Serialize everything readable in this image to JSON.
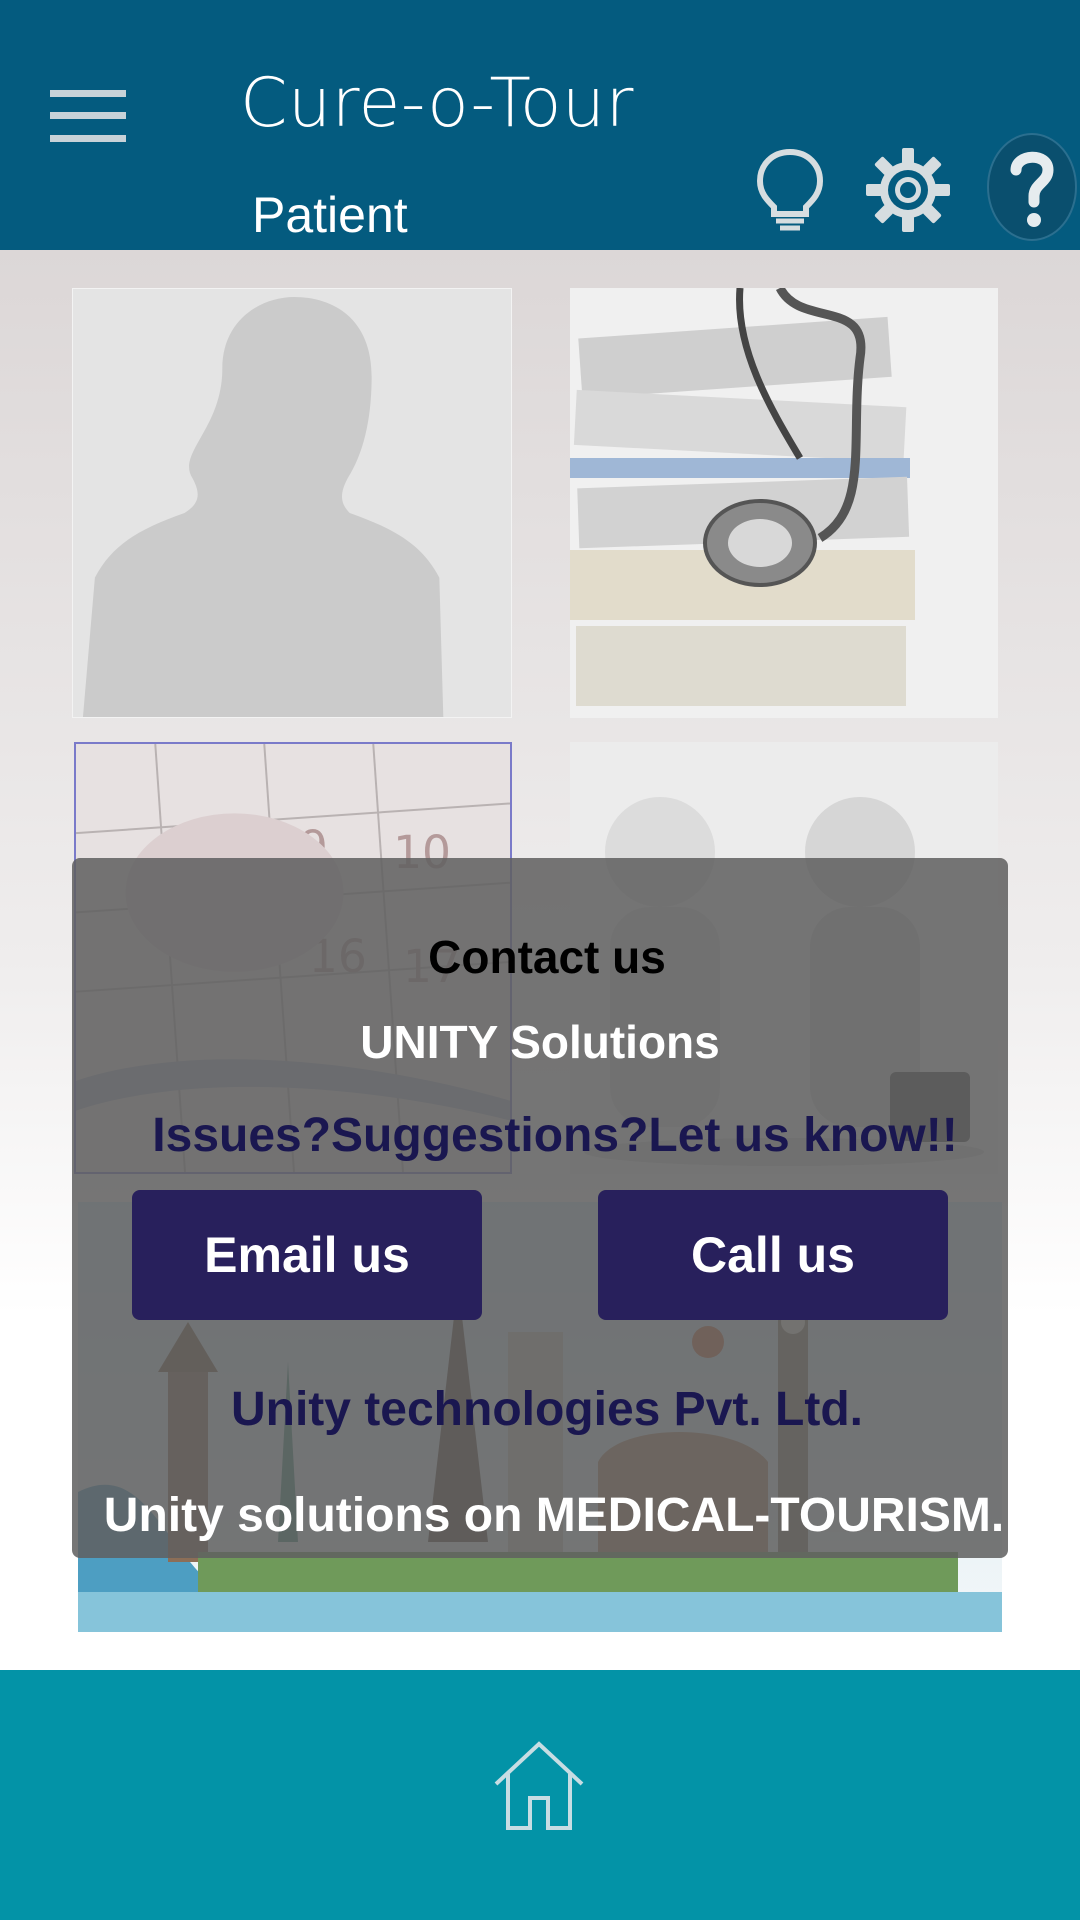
{
  "header": {
    "title": "Cure-o-Tour",
    "subtitle": "Patient",
    "icons": [
      "menu-icon",
      "lightbulb-icon",
      "gear-icon",
      "help-icon"
    ]
  },
  "tiles": [
    {
      "name": "profile",
      "image": "person-silhouette"
    },
    {
      "name": "medical-records",
      "image": "stethoscope-on-files"
    },
    {
      "name": "appointments",
      "image": "calendar"
    },
    {
      "name": "consultation",
      "image": "3d-figures-meeting"
    },
    {
      "name": "travel",
      "image": "world-landmarks"
    }
  ],
  "dialog": {
    "title": "Contact us",
    "company": "UNITY Solutions",
    "prompt": "Issues?Suggestions?Let us know!!",
    "email_label": "Email us",
    "call_label": "Call us",
    "organization": "Unity technologies Pvt. Ltd.",
    "tagline": "Unity solutions on MEDICAL-TOURISM."
  },
  "footer": {
    "icons": [
      "home-icon"
    ]
  },
  "colors": {
    "header_bg": "#045b7f",
    "footer_bg": "#0393a7",
    "dialog_button": "#28205c",
    "dialog_text_dark": "#1a1750"
  }
}
